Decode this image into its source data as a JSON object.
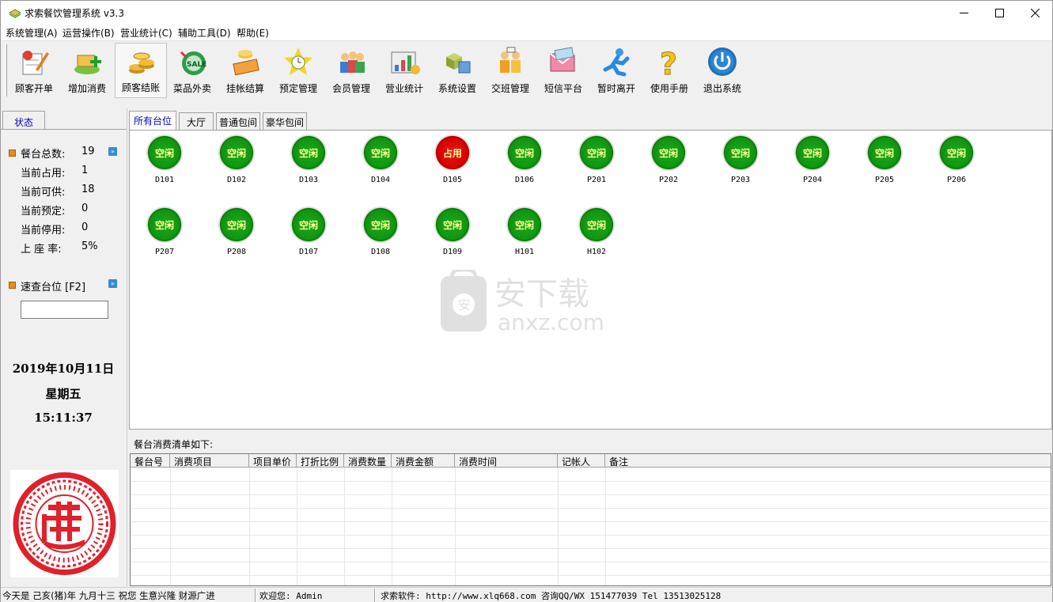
{
  "window": {
    "title": "求索餐饮管理系统 v3.3"
  },
  "menu": [
    "系统管理(A)",
    "运营操作(B)",
    "营业统计(C)",
    "辅助工具(D)",
    "帮助(E)"
  ],
  "toolbar": [
    {
      "label": "顾客开单",
      "icon": "order-pad-icon"
    },
    {
      "label": "增加消费",
      "icon": "add-consumption-icon"
    },
    {
      "label": "顾客结账",
      "icon": "coins-checkout-icon",
      "selected": true
    },
    {
      "label": "菜品外卖",
      "icon": "sale-ball-icon"
    },
    {
      "label": "挂帐结算",
      "icon": "credit-settle-icon"
    },
    {
      "label": "预定管理",
      "icon": "reservation-clock-icon"
    },
    {
      "label": "会员管理",
      "icon": "members-icon"
    },
    {
      "label": "营业统计",
      "icon": "statistics-chart-icon"
    },
    {
      "label": "系统设置",
      "icon": "settings-cubes-icon"
    },
    {
      "label": "交班管理",
      "icon": "shift-handover-icon"
    },
    {
      "label": "短信平台",
      "icon": "sms-envelope-icon"
    },
    {
      "label": "暂时离开",
      "icon": "running-man-icon"
    },
    {
      "label": "使用手册",
      "icon": "help-question-icon"
    },
    {
      "label": "退出系统",
      "icon": "power-icon"
    }
  ],
  "status_panel": {
    "tab": "状态",
    "rows": [
      {
        "label": "餐台总数:",
        "value": "19"
      },
      {
        "label": "当前占用:",
        "value": "1"
      },
      {
        "label": "当前可供:",
        "value": "18"
      },
      {
        "label": "当前预定:",
        "value": "0"
      },
      {
        "label": "当前停用:",
        "value": "0"
      },
      {
        "label": "上 座 率:",
        "value": "5%"
      }
    ],
    "quick_lookup": "速查台位 [F2]",
    "date": "2019年10月11日",
    "weekday": "星期五",
    "time": "15:11:37"
  },
  "tabs": [
    "所有台位",
    "大厅",
    "普通包间",
    "豪华包间"
  ],
  "tables": [
    {
      "name": "D101",
      "status": "空闲"
    },
    {
      "name": "D102",
      "status": "空闲"
    },
    {
      "name": "D103",
      "status": "空闲"
    },
    {
      "name": "D104",
      "status": "空闲"
    },
    {
      "name": "D105",
      "status": "占用"
    },
    {
      "name": "D106",
      "status": "空闲"
    },
    {
      "name": "P201",
      "status": "空闲"
    },
    {
      "name": "P202",
      "status": "空闲"
    },
    {
      "name": "P203",
      "status": "空闲"
    },
    {
      "name": "P204",
      "status": "空闲"
    },
    {
      "name": "P205",
      "status": "空闲"
    },
    {
      "name": "P206",
      "status": "空闲"
    },
    {
      "name": "P207",
      "status": "空闲"
    },
    {
      "name": "P208",
      "status": "空闲"
    },
    {
      "name": "D107",
      "status": "空闲"
    },
    {
      "name": "D108",
      "status": "空闲"
    },
    {
      "name": "D109",
      "status": "空闲"
    },
    {
      "name": "H101",
      "status": "空闲"
    },
    {
      "name": "H102",
      "status": "空闲"
    }
  ],
  "colors": {
    "free": "#119611",
    "occupied": "#d80000",
    "free_text": "#ffff90"
  },
  "watermark": {
    "cn": "安下载",
    "en": "anxz.com"
  },
  "bill": {
    "label": "餐台消费清单如下:",
    "columns": [
      "餐台号",
      "消费项目",
      "项目单价",
      "打折比例",
      "消费数量",
      "消费金额",
      "消费时间",
      "记帐人",
      "备注"
    ]
  },
  "statusbar": {
    "greeting": "今天是 己亥(猪)年 九月十三 祝您 生意兴隆 财源广进",
    "welcome": "欢迎您: Admin",
    "vendor": "求索软件: http://www.xlq668.com  咨询QQ/WX 151477039  Tel 13513025128"
  }
}
